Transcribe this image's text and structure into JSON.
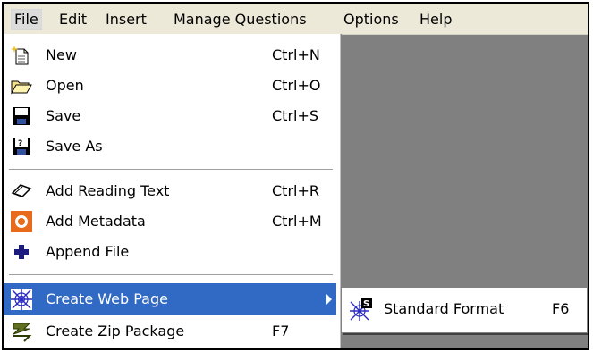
{
  "menubar": {
    "items": [
      {
        "label": "File"
      },
      {
        "label": "Edit"
      },
      {
        "label": "Insert"
      },
      {
        "label": "Manage Questions"
      },
      {
        "label": "Options"
      },
      {
        "label": "Help"
      }
    ],
    "active": "File"
  },
  "file_menu": {
    "items": [
      {
        "label": "New",
        "shortcut": "Ctrl+N",
        "icon": "new-file-icon"
      },
      {
        "label": "Open",
        "shortcut": "Ctrl+O",
        "icon": "open-folder-icon"
      },
      {
        "label": "Save",
        "shortcut": "Ctrl+S",
        "icon": "save-disk-icon"
      },
      {
        "label": "Save As",
        "shortcut": "",
        "icon": "save-as-icon"
      },
      {
        "label": "Add Reading Text",
        "shortcut": "Ctrl+R",
        "icon": "reading-text-icon"
      },
      {
        "label": "Add Metadata",
        "shortcut": "Ctrl+M",
        "icon": "metadata-icon"
      },
      {
        "label": "Append File",
        "shortcut": "",
        "icon": "plus-icon"
      },
      {
        "label": "Create Web Page",
        "shortcut": "",
        "icon": "web-page-icon",
        "highlighted": true,
        "has_submenu": true
      },
      {
        "label": "Create Zip Package",
        "shortcut": "F7",
        "icon": "zip-package-icon"
      }
    ]
  },
  "submenu": {
    "items": [
      {
        "label": "Standard Format",
        "shortcut": "F6",
        "icon": "standard-format-icon"
      }
    ]
  },
  "colors": {
    "highlight": "#316ac5",
    "menubar_bg": "#ece9d8",
    "workspace": "#808080"
  }
}
